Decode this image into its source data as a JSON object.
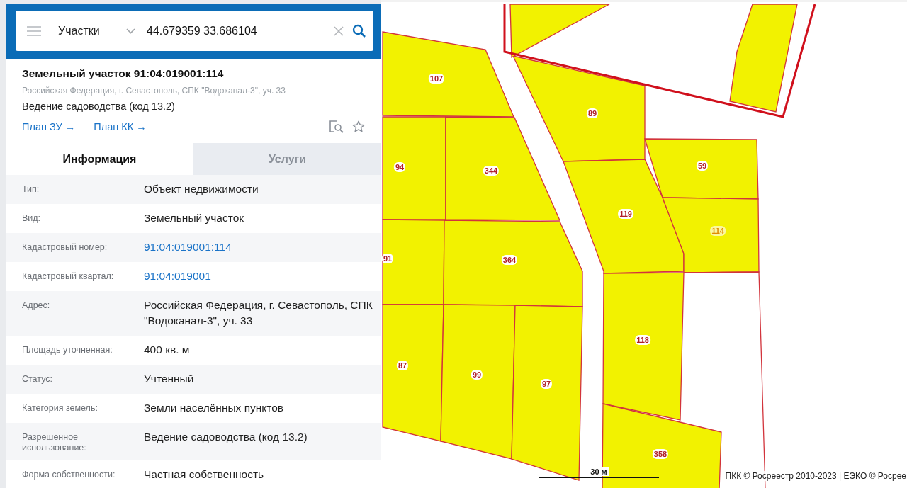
{
  "search": {
    "category": "Участки",
    "query": "44.679359 33.686104"
  },
  "card": {
    "title": "Земельный участок 91:04:019001:114",
    "address": "Российская Федерация, г. Севастополь, СПК \"Водоканал-3\", уч. 33",
    "usage": "Ведение садоводства (код 13.2)",
    "links": [
      "План ЗУ →",
      "План КК →"
    ]
  },
  "tabs": [
    {
      "label": "Информация",
      "selected": true
    },
    {
      "label": "Услуги",
      "selected": false
    }
  ],
  "info": [
    {
      "label": "Тип:",
      "value": "Объект недвижимости",
      "kind": "text"
    },
    {
      "label": "Вид:",
      "value": "Земельный участок",
      "kind": "text"
    },
    {
      "label": "Кадастровый номер:",
      "value": "91:04:019001:114",
      "kind": "link"
    },
    {
      "label": "Кадастровый квартал:",
      "value": "91:04:019001",
      "kind": "link"
    },
    {
      "label": "Адрес:",
      "value": "Российская Федерация, г. Севастополь, СПК \"Водоканал-3\", уч. 33",
      "kind": "text"
    },
    {
      "label": "Площадь уточненная:",
      "value": "400 кв. м",
      "kind": "text"
    },
    {
      "label": "Статус:",
      "value": "Учтенный",
      "kind": "text"
    },
    {
      "label": "Категория земель:",
      "value": "Земли населённых пунктов",
      "kind": "text"
    },
    {
      "label": "Разрешенное использование:",
      "value": "Ведение садоводства (код 13.2)",
      "kind": "text"
    },
    {
      "label": "Форма собственности:",
      "value": "Частная собственность",
      "kind": "text"
    }
  ],
  "map": {
    "parcels": [
      {
        "label": "107",
        "selected": false
      },
      {
        "label": "94",
        "selected": false
      },
      {
        "label": "344",
        "selected": false
      },
      {
        "label": "91",
        "selected": false
      },
      {
        "label": "364",
        "selected": false
      },
      {
        "label": "89",
        "selected": false
      },
      {
        "label": "59",
        "selected": false
      },
      {
        "label": "119",
        "selected": false
      },
      {
        "label": "114",
        "selected": true
      },
      {
        "label": "118",
        "selected": false
      },
      {
        "label": "87",
        "selected": false
      },
      {
        "label": "99",
        "selected": false
      },
      {
        "label": "97",
        "selected": false
      },
      {
        "label": "358",
        "selected": false
      }
    ],
    "scale": "30 м",
    "attribution": "ПКК © Росреестр 2010-2023 | ЕЭКО © Росрее"
  }
}
